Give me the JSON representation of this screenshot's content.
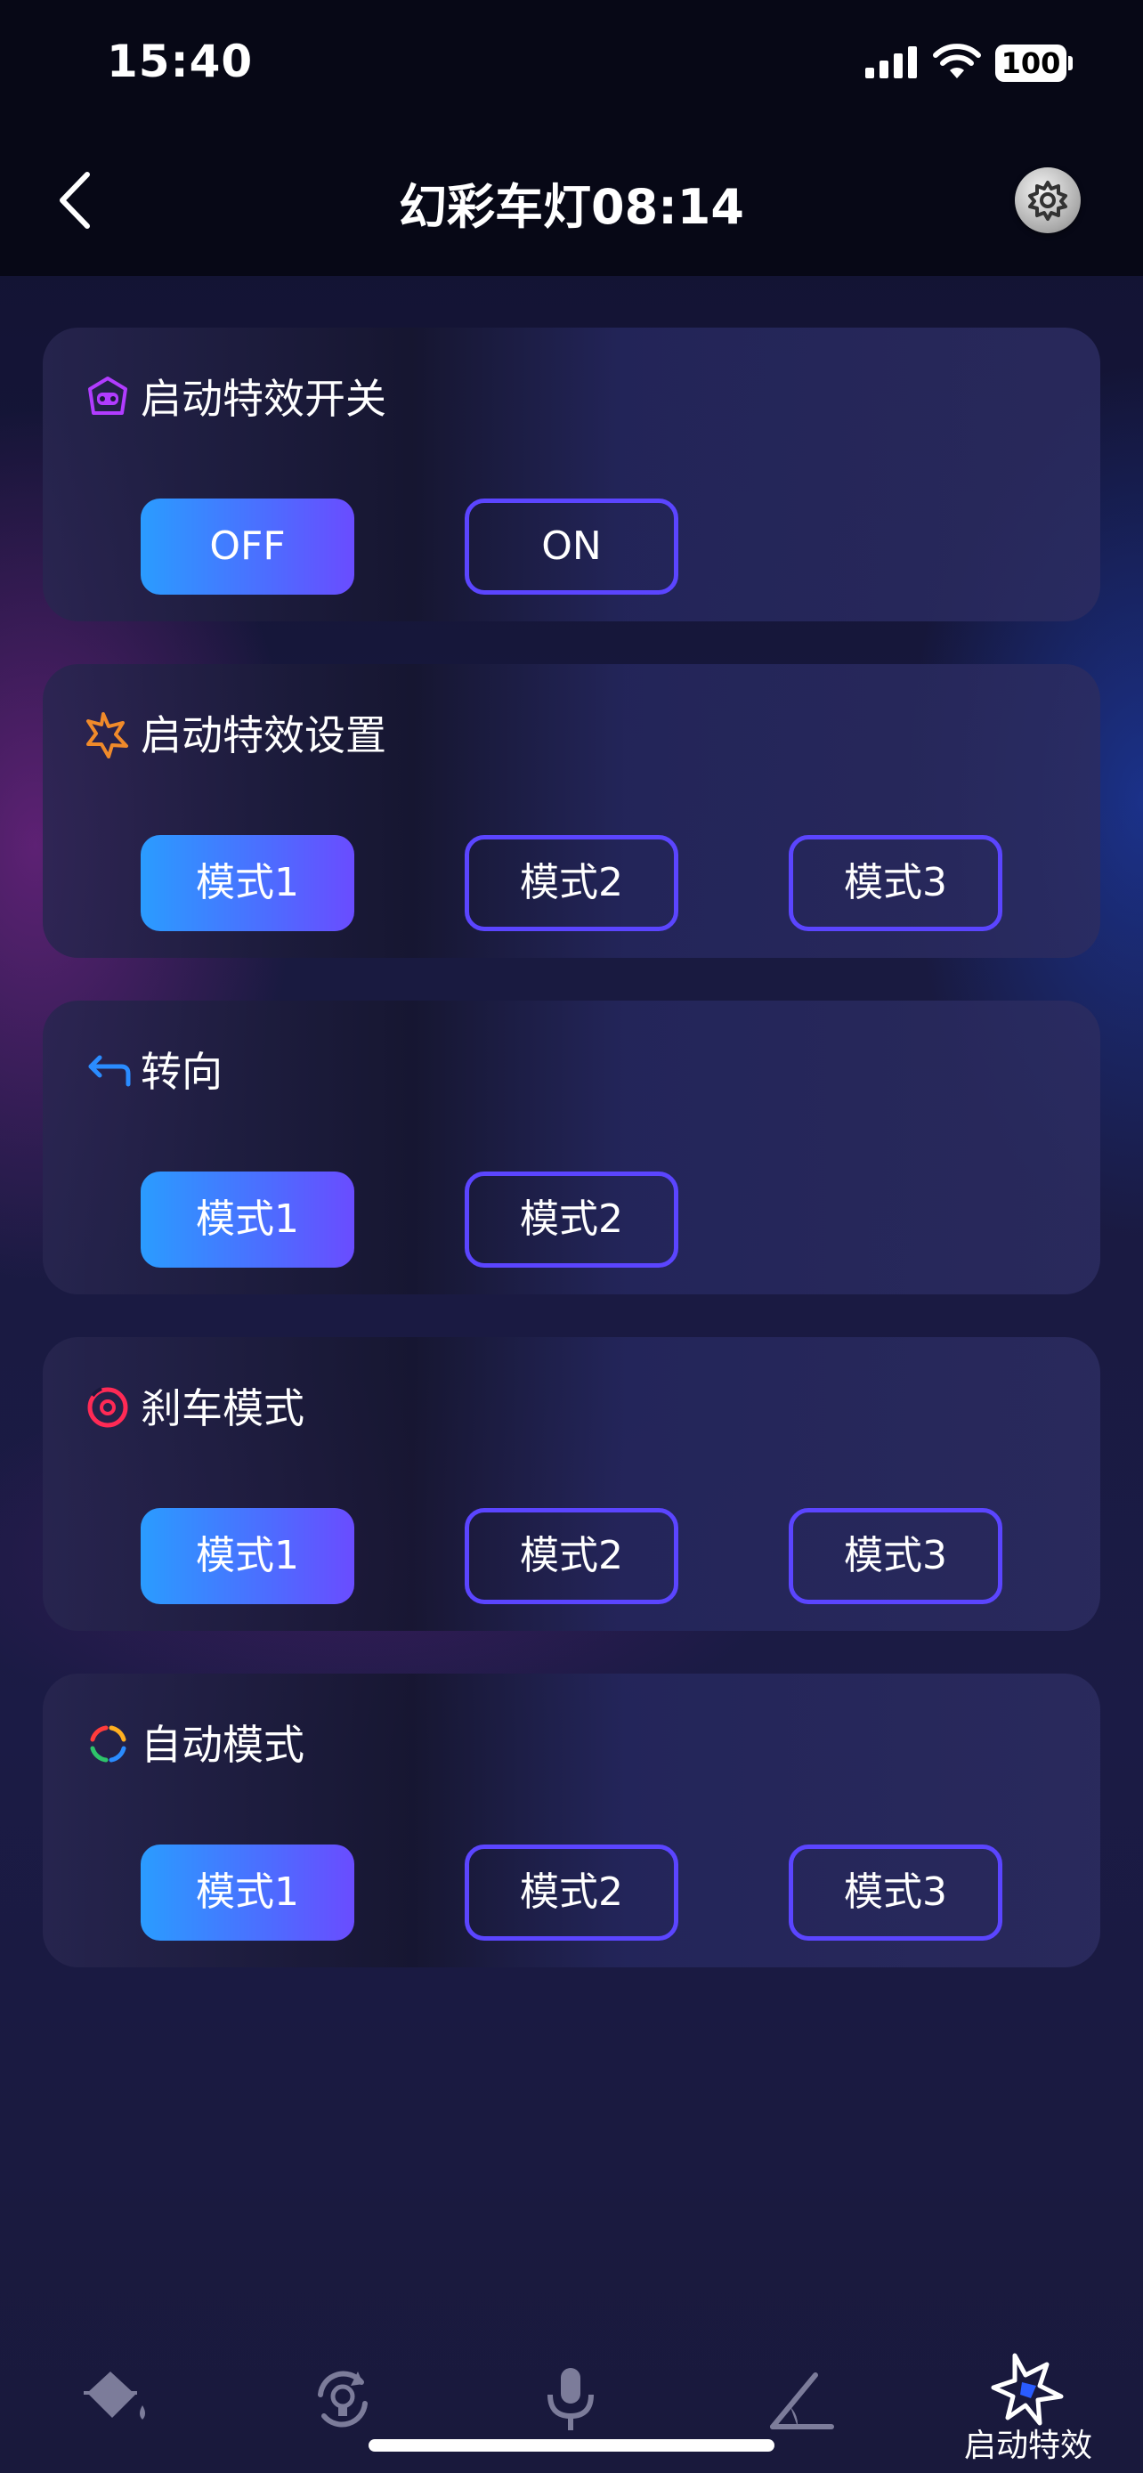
{
  "status": {
    "time": "15:40",
    "battery": "100"
  },
  "header": {
    "title": "幻彩车灯08:14"
  },
  "cards": [
    {
      "title": "启动特效开关",
      "icon": "robot-icon",
      "buttons": [
        "OFF",
        "ON"
      ],
      "selected": 0
    },
    {
      "title": "启动特效设置",
      "icon": "star-icon",
      "buttons": [
        "模式1",
        "模式2",
        "模式3"
      ],
      "selected": 0
    },
    {
      "title": "转向",
      "icon": "turn-arrow-icon",
      "buttons": [
        "模式1",
        "模式2"
      ],
      "selected": 0
    },
    {
      "title": "刹车模式",
      "icon": "brake-icon",
      "buttons": [
        "模式1",
        "模式2",
        "模式3"
      ],
      "selected": 0
    },
    {
      "title": "自动模式",
      "icon": "auto-cycle-icon",
      "buttons": [
        "模式1",
        "模式2",
        "模式3"
      ],
      "selected": 0
    }
  ],
  "tabbar": {
    "items": [
      {
        "icon": "paint-bucket-icon"
      },
      {
        "icon": "rotating-bulb-icon"
      },
      {
        "icon": "microphone-icon"
      },
      {
        "icon": "angle-icon"
      },
      {
        "icon": "startup-effect-star-icon",
        "label": "启动特效",
        "active": true
      }
    ]
  },
  "colors": {
    "accent": "#5b45ff",
    "active_start": "#2a9cff",
    "active_end": "#6a4cff"
  }
}
